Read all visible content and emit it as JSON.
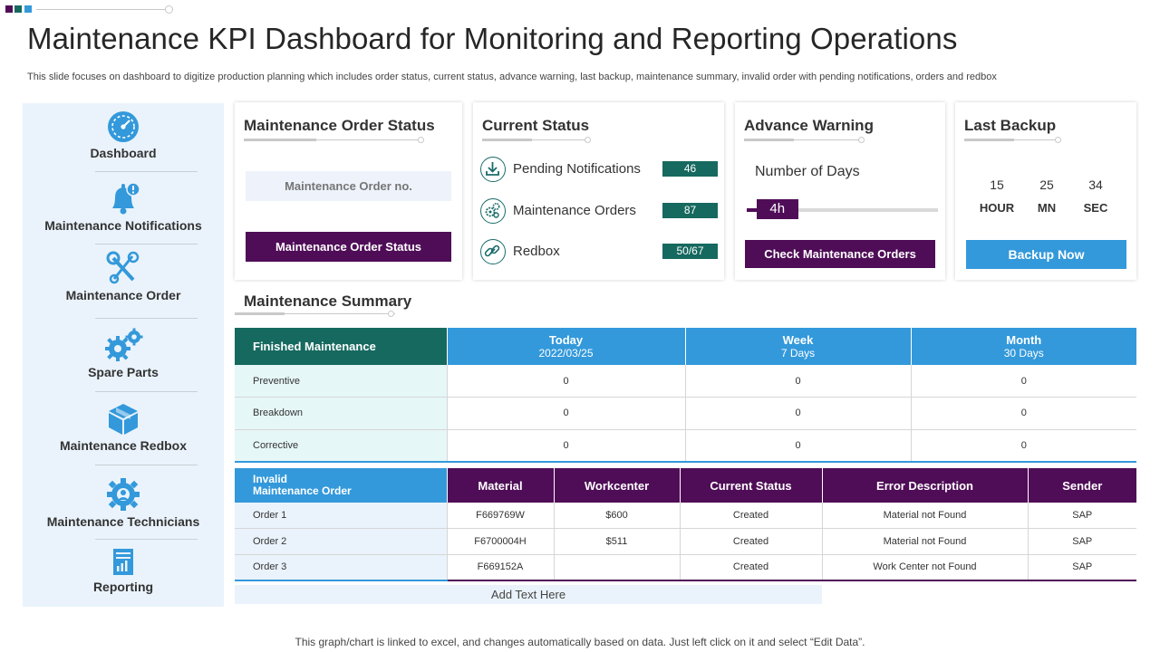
{
  "header": {
    "title": "Maintenance KPI Dashboard for Monitoring and Reporting Operations",
    "subtitle": "This slide focuses on dashboard to digitize production planning which includes order status, current status, advance warning, last backup, maintenance summary, invalid order with pending notifications, orders and redbox"
  },
  "colors": {
    "accent_blue": "#3399db",
    "accent_purple": "#4f0d57",
    "accent_teal": "#16695f",
    "sidebar_bg": "#eaf3fb"
  },
  "sidebar": {
    "items": [
      {
        "label": "Dashboard",
        "icon": "speedometer-icon"
      },
      {
        "label": "Maintenance Notifications",
        "icon": "bell-alert-icon"
      },
      {
        "label": "Maintenance Order",
        "icon": "tools-icon"
      },
      {
        "label": "Spare Parts",
        "icon": "gears-icon"
      },
      {
        "label": "Maintenance Redbox",
        "icon": "box-icon"
      },
      {
        "label": "Maintenance Technicians",
        "icon": "technician-gear-icon"
      },
      {
        "label": "Reporting",
        "icon": "report-icon"
      }
    ]
  },
  "order_status": {
    "title": "Maintenance Order Status",
    "order_no_placeholder": "Maintenance Order no.",
    "button_label": "Maintenance Order Status"
  },
  "current_status": {
    "title": "Current Status",
    "rows": [
      {
        "label": "Pending Notifications",
        "value": "46",
        "icon": "download-icon"
      },
      {
        "label": "Maintenance Orders",
        "value": "87",
        "icon": "gears-icon"
      },
      {
        "label": "Redbox",
        "value": "50/67",
        "icon": "link-icon"
      }
    ]
  },
  "advance_warning": {
    "title": "Advance Warning",
    "label": "Number of Days",
    "slider_value": "4h",
    "slider_fraction": 0.16,
    "button_label": "Check Maintenance Orders"
  },
  "last_backup": {
    "title": "Last Backup",
    "hour": "15",
    "minute": "25",
    "second": "34",
    "hour_label": "HOUR",
    "minute_label": "MN",
    "second_label": "SEC",
    "button_label": "Backup Now"
  },
  "summary": {
    "title": "Maintenance Summary",
    "finished": {
      "row_header": "Finished Maintenance",
      "columns": [
        {
          "title": "Today",
          "sub": "2022/03/25"
        },
        {
          "title": "Week",
          "sub": "7 Days"
        },
        {
          "title": "Month",
          "sub": "30 Days"
        }
      ],
      "rows": [
        {
          "label": "Preventive",
          "values": [
            "0",
            "0",
            "0"
          ]
        },
        {
          "label": "Breakdown",
          "values": [
            "0",
            "0",
            "0"
          ]
        },
        {
          "label": "Corrective",
          "values": [
            "0",
            "0",
            "0"
          ]
        }
      ]
    },
    "invalid": {
      "row_header_line1": "Invalid",
      "row_header_line2": "Maintenance Order",
      "columns": [
        "Material",
        "Workcenter",
        "Current Status",
        "Error Description",
        "Sender"
      ],
      "rows": [
        {
          "label": "Order 1",
          "values": [
            "F669769W",
            "$600",
            "Created",
            "Material not Found",
            "SAP"
          ]
        },
        {
          "label": "Order 2",
          "values": [
            "F6700004H",
            "$511",
            "Created",
            "Material not Found",
            "SAP"
          ]
        },
        {
          "label": "Order 3",
          "values": [
            "F669152A",
            "",
            "Created",
            "Work Center not Found",
            "SAP"
          ]
        }
      ]
    }
  },
  "add_text": "Add Text Here",
  "footer_note": "This graph/chart is linked to excel,  and changes automatically based on data. Just left click on it and select “Edit Data”."
}
